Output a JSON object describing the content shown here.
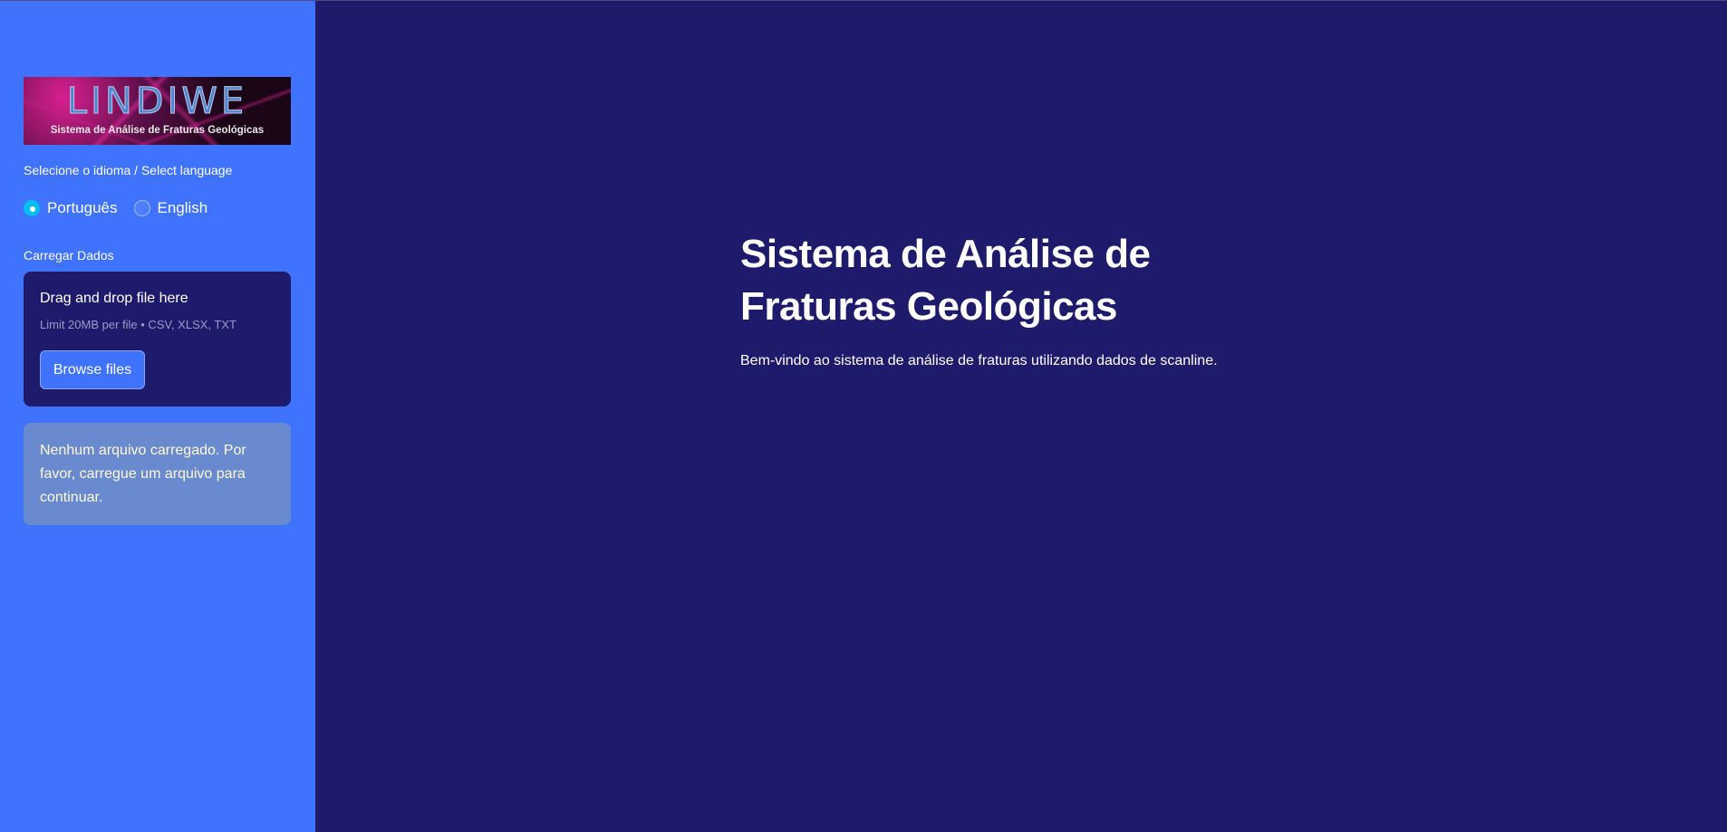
{
  "sidebar": {
    "logo": {
      "title": "LINDIWE",
      "subtitle": "Sistema de Análise de Fraturas Geológicas"
    },
    "language_label": "Selecione o idioma / Select language",
    "language_options": [
      "Português",
      "English"
    ],
    "language_selected": "Português",
    "upload_label": "Carregar Dados",
    "dropzone": {
      "title": "Drag and drop file here",
      "limit": "Limit 20MB per file • CSV, XLSX, TXT",
      "button": "Browse files"
    },
    "info_message": "Nenhum arquivo carregado. Por favor, carregue um arquivo para continuar."
  },
  "main": {
    "title": "Sistema de Análise de Fraturas Geológicas",
    "description": "Bem-vindo ao sistema de análise de fraturas utilizando dados de scanline."
  },
  "colors": {
    "sidebar_bg": "#3f72fd",
    "main_bg": "#1f1b6c",
    "radio_checked": "#00c0f2",
    "info_bg": "#6a8ad0"
  }
}
